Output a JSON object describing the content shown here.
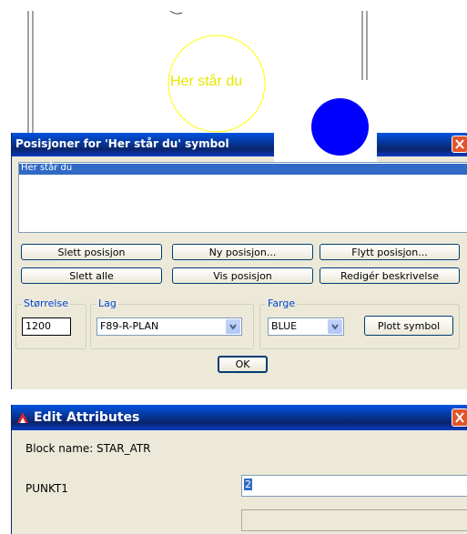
{
  "drawing": {
    "circle_text": "Her står du",
    "circle_color": "#ffff00",
    "marker_color": "#0000ff"
  },
  "dialog1": {
    "title": "Posisjoner for 'Her står du' symbol",
    "list_items": [
      "Her står du"
    ],
    "buttons": {
      "delete_position": "Slett posisjon",
      "new_position": "Ny posisjon...",
      "move_position": "Flytt posisjon...",
      "delete_all": "Slett alle",
      "show_position": "Vis posisjon",
      "edit_description": "Redigér beskrivelse",
      "plot_symbol": "Plott symbol",
      "ok": "OK"
    },
    "size": {
      "label": "Størrelse",
      "value": "1200"
    },
    "layer": {
      "label": "Lag",
      "value": "F89-R-PLAN"
    },
    "color": {
      "label": "Farge",
      "value": "BLUE"
    }
  },
  "dialog2": {
    "title": "Edit Attributes",
    "block_label": "Block name:",
    "block_value": "STAR_ATR",
    "attr_label": "PUNKT1",
    "attr_value": "2"
  },
  "colors": {
    "titlebar": "#0a246a",
    "dialog_bg": "#ece9d8",
    "close_button": "#e2542c"
  }
}
